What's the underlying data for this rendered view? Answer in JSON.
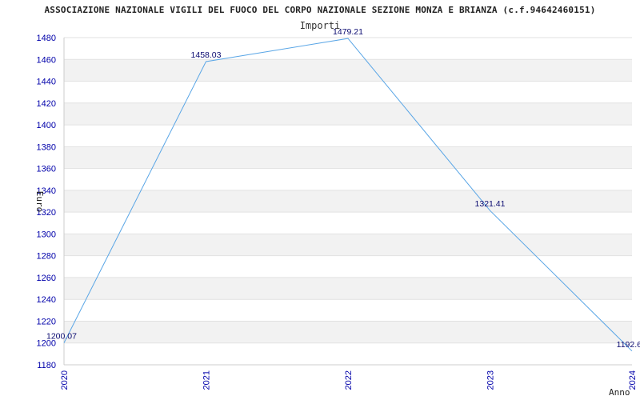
{
  "chart_data": {
    "type": "line",
    "title": "ASSOCIAZIONE NAZIONALE VIGILI DEL FUOCO DEL CORPO NAZIONALE SEZIONE MONZA E BRIANZA (c.f.94642460151)",
    "series_label": "Importi",
    "xlabel": "Anno",
    "ylabel": "Euro",
    "categories": [
      "2020",
      "2021",
      "2022",
      "2023",
      "2024"
    ],
    "series": [
      {
        "name": "Importi",
        "values": [
          1200.07,
          1458.03,
          1479.21,
          1321.41,
          1192.6
        ],
        "labels": [
          "1200.07",
          "1458.03",
          "1479.21",
          "1321.41",
          "1192.6"
        ]
      }
    ],
    "yticks": [
      1180,
      1200,
      1220,
      1240,
      1260,
      1280,
      1300,
      1320,
      1340,
      1360,
      1380,
      1400,
      1420,
      1440,
      1460,
      1480
    ],
    "ylim": [
      1180,
      1480
    ],
    "grid": true,
    "line_color": "#5aa6e6",
    "band_color": "#f2f2f2",
    "tick_color": "#0000aa"
  }
}
